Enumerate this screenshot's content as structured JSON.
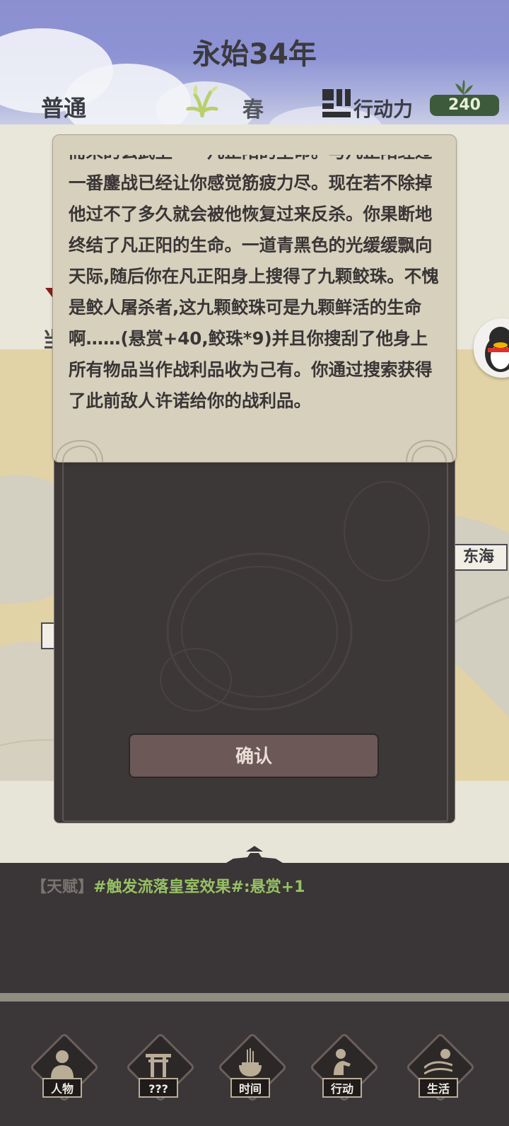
{
  "header": {
    "year": "永始34年",
    "mode": "普通",
    "season": "春",
    "action_label": "行动力",
    "action_points": "240"
  },
  "map": {
    "east_sea_label": "东海",
    "partial_char": "当"
  },
  "dialog": {
    "text": "而来的玄武卫——凡正阳的生命。与凡正阳经过一番鏖战已经让你感觉筋疲力尽。现在若不除掉他过不了多久就会被他恢复过来反杀。你果断地终结了凡正阳的生命。一道青黑色的光缓缓飘向天际,随后你在凡正阳身上搜得了九颗鲛珠。不愧是鲛人屠杀者,这九颗鲛珠可是九颗鲜活的生命啊……(悬赏+40,鲛珠*9)并且你搜刮了他身上所有物品当作战利品收为己有。你通过搜索获得了此前敌人许诺给你的战利品。",
    "confirm_label": "确认"
  },
  "log": {
    "tag": "【天赋】",
    "text": "#触发流落皇室效果#:悬赏+1"
  },
  "nav": {
    "items": [
      {
        "label": "人物",
        "icon": "person-icon"
      },
      {
        "label": "???",
        "icon": "shrine-gate-icon"
      },
      {
        "label": "时间",
        "icon": "incense-burner-icon"
      },
      {
        "label": "行动",
        "icon": "action-figure-icon"
      },
      {
        "label": "生活",
        "icon": "landscape-sun-icon"
      }
    ]
  },
  "colors": {
    "accent_green": "#96c264",
    "badge_green": "#3d5a3a",
    "panel_dark": "#3a3536",
    "paper": "#d6d0bd"
  }
}
